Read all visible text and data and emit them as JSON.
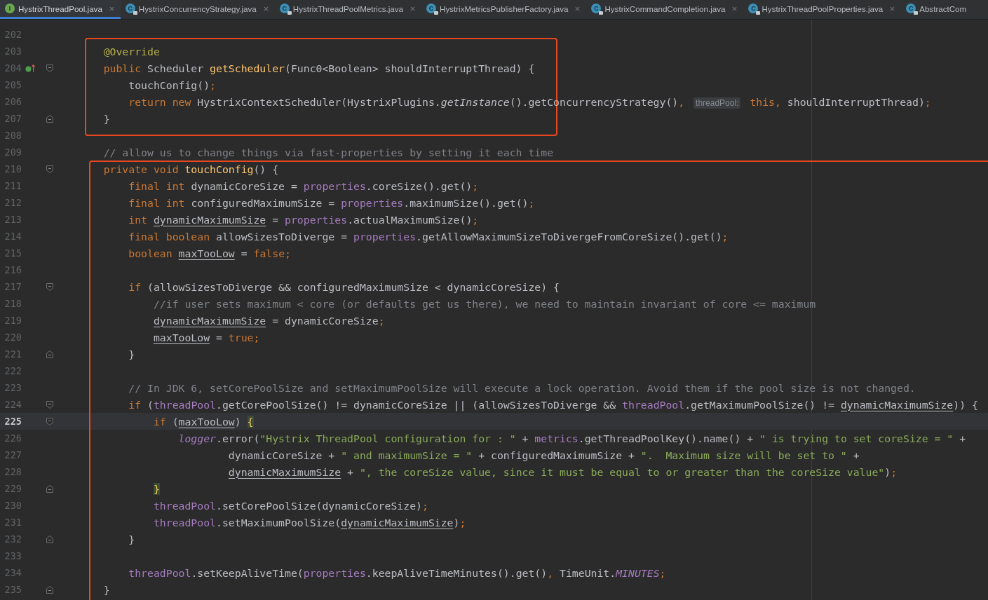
{
  "tabs": [
    {
      "label": "HystrixThreadPool.java",
      "kind": "interface",
      "badge": "I",
      "selected": true,
      "closable": true
    },
    {
      "label": "HystrixConcurrencyStrategy.java",
      "kind": "locked-class",
      "badge": "C",
      "selected": false,
      "closable": true
    },
    {
      "label": "HystrixThreadPoolMetrics.java",
      "kind": "locked-class",
      "badge": "C",
      "selected": false,
      "closable": true
    },
    {
      "label": "HystrixMetricsPublisherFactory.java",
      "kind": "locked-class",
      "badge": "C",
      "selected": false,
      "closable": true
    },
    {
      "label": "HystrixCommandCompletion.java",
      "kind": "locked-class",
      "badge": "C",
      "selected": false,
      "closable": true
    },
    {
      "label": "HystrixThreadPoolProperties.java",
      "kind": "locked-class",
      "badge": "C",
      "selected": false,
      "closable": true
    },
    {
      "label": "AbstractCom",
      "kind": "locked-class",
      "badge": "C",
      "selected": false,
      "closable": false
    }
  ],
  "editor": {
    "blocks": [
      {
        "kind": "unframed",
        "lines": [
          {
            "number": "202",
            "current": false
          }
        ]
      },
      {
        "kind": "short-frame",
        "lines": [
          {
            "number": "203",
            "current": false,
            "tokens": [
              {
                "kind": "annotation",
                "text": "    @Override"
              }
            ]
          },
          {
            "number": "204",
            "current": false,
            "override_mark": true,
            "fold_start": true,
            "tokens": [
              {
                "kind": "keyword",
                "text": "    public "
              },
              {
                "kind": "plain",
                "text": "Scheduler "
              },
              {
                "kind": "declaration",
                "text": "getScheduler"
              },
              {
                "kind": "plain",
                "text": "(Func0<Boolean> shouldInterruptThread) {"
              }
            ]
          },
          {
            "number": "205",
            "current": false,
            "tokens": [
              {
                "kind": "plain",
                "text": "        touchConfig()"
              },
              {
                "kind": "keyword",
                "text": ";"
              }
            ]
          },
          {
            "number": "206",
            "current": false,
            "tokens": [
              {
                "kind": "keyword",
                "text": "        return new "
              },
              {
                "kind": "plain",
                "text": "HystrixContextScheduler(HystrixPlugins."
              },
              {
                "kind": "static-call",
                "text": "getInstance"
              },
              {
                "kind": "plain",
                "text": "().getConcurrencyStrategy()"
              },
              {
                "kind": "keyword",
                "text": ", "
              },
              {
                "kind": "inlay-hint",
                "text": "threadPool:"
              },
              {
                "kind": "keyword",
                "text": " this, "
              },
              {
                "kind": "plain",
                "text": "shouldInterruptThread)"
              },
              {
                "kind": "keyword",
                "text": ";"
              }
            ]
          },
          {
            "number": "207",
            "current": false,
            "fold_end": true,
            "tokens": [
              {
                "kind": "plain",
                "text": "    }"
              }
            ]
          }
        ]
      },
      {
        "kind": "unframed",
        "lines": [
          {
            "number": "208",
            "current": false
          },
          {
            "number": "209",
            "current": false,
            "tokens": [
              {
                "kind": "comment",
                "text": "    // allow us to change things via fast-properties by setting it each time"
              }
            ]
          }
        ]
      },
      {
        "kind": "wide-frame",
        "lines": [
          {
            "number": "210",
            "current": false,
            "fold_start": true,
            "tokens": [
              {
                "kind": "keyword",
                "text": "    private void "
              },
              {
                "kind": "declaration",
                "text": "touchConfig"
              },
              {
                "kind": "plain",
                "text": "() {"
              }
            ]
          },
          {
            "number": "211",
            "current": false,
            "tokens": [
              {
                "kind": "keyword",
                "text": "        final int "
              },
              {
                "kind": "plain",
                "text": "dynamicCoreSize = "
              },
              {
                "kind": "field",
                "text": "properties"
              },
              {
                "kind": "plain",
                "text": ".coreSize().get()"
              },
              {
                "kind": "keyword",
                "text": ";"
              }
            ]
          },
          {
            "number": "212",
            "current": false,
            "tokens": [
              {
                "kind": "keyword",
                "text": "        final int "
              },
              {
                "kind": "plain",
                "text": "configuredMaximumSize = "
              },
              {
                "kind": "field",
                "text": "properties"
              },
              {
                "kind": "plain",
                "text": ".maximumSize().get()"
              },
              {
                "kind": "keyword",
                "text": ";"
              }
            ]
          },
          {
            "number": "213",
            "current": false,
            "tokens": [
              {
                "kind": "keyword",
                "text": "        int "
              },
              {
                "kind": "mutable",
                "text": "dynamicMaximumSize"
              },
              {
                "kind": "plain",
                "text": " = "
              },
              {
                "kind": "field",
                "text": "properties"
              },
              {
                "kind": "plain",
                "text": ".actualMaximumSize()"
              },
              {
                "kind": "keyword",
                "text": ";"
              }
            ]
          },
          {
            "number": "214",
            "current": false,
            "tokens": [
              {
                "kind": "keyword",
                "text": "        final boolean "
              },
              {
                "kind": "plain",
                "text": "allowSizesToDiverge = "
              },
              {
                "kind": "field",
                "text": "properties"
              },
              {
                "kind": "plain",
                "text": ".getAllowMaximumSizeToDivergeFromCoreSize().get()"
              },
              {
                "kind": "keyword",
                "text": ";"
              }
            ]
          },
          {
            "number": "215",
            "current": false,
            "tokens": [
              {
                "kind": "keyword",
                "text": "        boolean "
              },
              {
                "kind": "mutable",
                "text": "maxTooLow"
              },
              {
                "kind": "plain",
                "text": " = "
              },
              {
                "kind": "keyword",
                "text": "false;"
              }
            ]
          },
          {
            "number": "216",
            "current": false
          },
          {
            "number": "217",
            "current": false,
            "fold_start": true,
            "tokens": [
              {
                "kind": "keyword",
                "text": "        if "
              },
              {
                "kind": "plain",
                "text": "(allowSizesToDiverge && configuredMaximumSize < dynamicCoreSize) {"
              }
            ]
          },
          {
            "number": "218",
            "current": false,
            "tokens": [
              {
                "kind": "comment",
                "text": "            //if user sets maximum < core (or defaults get us there), we need to maintain invariant of core <= maximum"
              }
            ]
          },
          {
            "number": "219",
            "current": false,
            "tokens": [
              {
                "kind": "mutable",
                "text": "            dynamicMaximumSize"
              },
              {
                "kind": "plain",
                "text": " = dynamicCoreSize"
              },
              {
                "kind": "keyword",
                "text": ";"
              }
            ]
          },
          {
            "number": "220",
            "current": false,
            "tokens": [
              {
                "kind": "mutable",
                "text": "            maxTooLow"
              },
              {
                "kind": "plain",
                "text": " = "
              },
              {
                "kind": "keyword",
                "text": "true;"
              }
            ]
          },
          {
            "number": "221",
            "current": false,
            "fold_end": true,
            "tokens": [
              {
                "kind": "plain",
                "text": "        }"
              }
            ]
          },
          {
            "number": "222",
            "current": false
          },
          {
            "number": "223",
            "current": false,
            "tokens": [
              {
                "kind": "comment",
                "text": "        // In JDK 6, setCorePoolSize and setMaximumPoolSize will execute a lock operation. Avoid them if the pool size is not changed."
              }
            ]
          },
          {
            "number": "224",
            "current": false,
            "fold_start": true,
            "tokens": [
              {
                "kind": "keyword",
                "text": "        if "
              },
              {
                "kind": "plain",
                "text": "("
              },
              {
                "kind": "field",
                "text": "threadPool"
              },
              {
                "kind": "plain",
                "text": ".getCorePoolSize() != dynamicCoreSize || (allowSizesToDiverge && "
              },
              {
                "kind": "field",
                "text": "threadPool"
              },
              {
                "kind": "plain",
                "text": ".getMaximumPoolSize() != "
              },
              {
                "kind": "mutable",
                "text": "dynamicMaximumSize"
              },
              {
                "kind": "plain",
                "text": ")) {"
              }
            ]
          },
          {
            "number": "225",
            "current": true,
            "fold_start": true,
            "tokens": [
              {
                "kind": "keyword",
                "text": "            if "
              },
              {
                "kind": "plain",
                "text": "("
              },
              {
                "kind": "mutable",
                "text": "maxTooLow"
              },
              {
                "kind": "plain",
                "text": ") "
              },
              {
                "kind": "matched-brace",
                "text": "{"
              }
            ]
          },
          {
            "number": "226",
            "current": false,
            "tokens": [
              {
                "kind": "static-field",
                "text": "                logger"
              },
              {
                "kind": "plain",
                "text": ".error("
              },
              {
                "kind": "string",
                "text": "\"Hystrix ThreadPool configuration for : \""
              },
              {
                "kind": "plain",
                "text": " + "
              },
              {
                "kind": "field",
                "text": "metrics"
              },
              {
                "kind": "plain",
                "text": ".getThreadPoolKey().name() + "
              },
              {
                "kind": "string",
                "text": "\" is trying to set coreSize = \""
              },
              {
                "kind": "plain",
                "text": " +"
              }
            ]
          },
          {
            "number": "227",
            "current": false,
            "tokens": [
              {
                "kind": "plain",
                "text": "                        dynamicCoreSize + "
              },
              {
                "kind": "string",
                "text": "\" and maximumSize = \""
              },
              {
                "kind": "plain",
                "text": " + configuredMaximumSize + "
              },
              {
                "kind": "string",
                "text": "\".  Maximum size will be set to \""
              },
              {
                "kind": "plain",
                "text": " +"
              }
            ]
          },
          {
            "number": "228",
            "current": false,
            "tokens": [
              {
                "kind": "mutable",
                "text": "                        dynamicMaximumSize"
              },
              {
                "kind": "plain",
                "text": " + "
              },
              {
                "kind": "string",
                "text": "\", the coreSize value, since it must be equal to or greater than the coreSize value\""
              },
              {
                "kind": "plain",
                "text": ")"
              },
              {
                "kind": "keyword",
                "text": ";"
              }
            ]
          },
          {
            "number": "229",
            "current": false,
            "fold_end": true,
            "tokens": [
              {
                "kind": "matched-brace",
                "text": "            }"
              }
            ]
          },
          {
            "number": "230",
            "current": false,
            "tokens": [
              {
                "kind": "field",
                "text": "            threadPool"
              },
              {
                "kind": "plain",
                "text": ".setCorePoolSize(dynamicCoreSize)"
              },
              {
                "kind": "keyword",
                "text": ";"
              }
            ]
          },
          {
            "number": "231",
            "current": false,
            "tokens": [
              {
                "kind": "field",
                "text": "            threadPool"
              },
              {
                "kind": "plain",
                "text": ".setMaximumPoolSize("
              },
              {
                "kind": "mutable",
                "text": "dynamicMaximumSize"
              },
              {
                "kind": "plain",
                "text": ")"
              },
              {
                "kind": "keyword",
                "text": ";"
              }
            ]
          },
          {
            "number": "232",
            "current": false,
            "fold_end": true,
            "tokens": [
              {
                "kind": "plain",
                "text": "        }"
              }
            ]
          },
          {
            "number": "233",
            "current": false
          },
          {
            "number": "234",
            "current": false,
            "tokens": [
              {
                "kind": "field",
                "text": "        threadPool"
              },
              {
                "kind": "plain",
                "text": ".setKeepAliveTime("
              },
              {
                "kind": "field",
                "text": "properties"
              },
              {
                "kind": "plain",
                "text": ".keepAliveTimeMinutes().get()"
              },
              {
                "kind": "keyword",
                "text": ", "
              },
              {
                "kind": "plain",
                "text": "TimeUnit."
              },
              {
                "kind": "static-field",
                "text": "MINUTES"
              },
              {
                "kind": "keyword",
                "text": ";"
              }
            ]
          },
          {
            "number": "235",
            "current": false,
            "fold_end": true,
            "tokens": [
              {
                "kind": "plain",
                "text": "    }"
              }
            ]
          }
        ]
      }
    ]
  }
}
